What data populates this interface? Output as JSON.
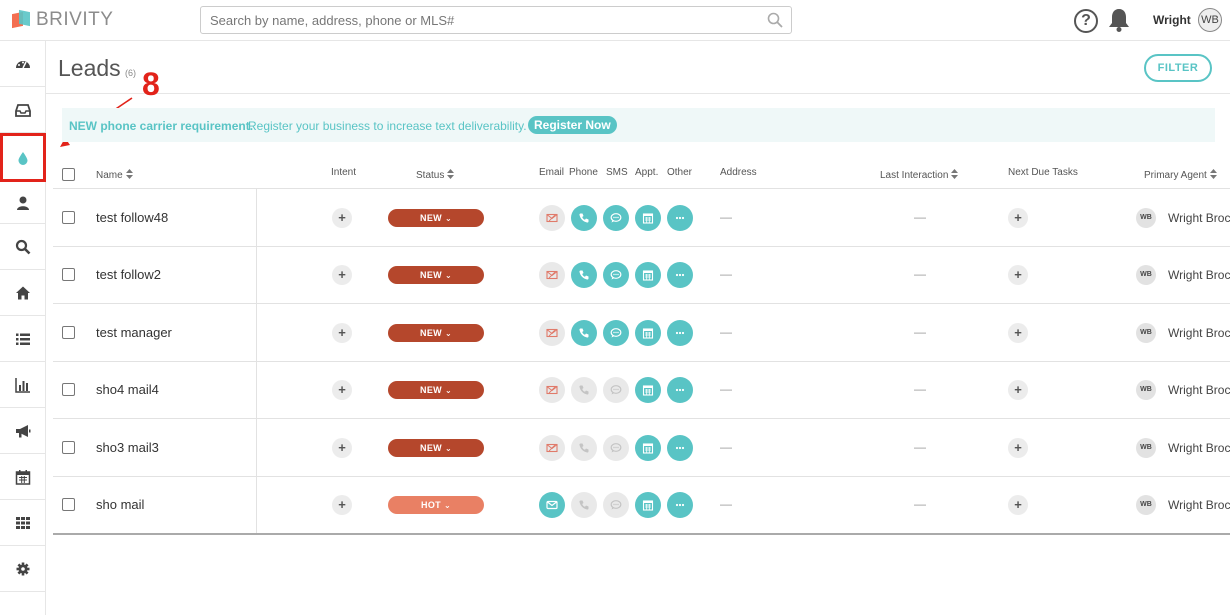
{
  "app": {
    "logo_text": "BRIVITY"
  },
  "search": {
    "placeholder": "Search by name, address, phone or MLS#"
  },
  "topbar": {
    "help_glyph": "?",
    "user_name": "Wright",
    "user_initials": "WB"
  },
  "sidebar": {
    "items": [
      {
        "icon": "dashboard-icon",
        "active": false
      },
      {
        "icon": "inbox-icon",
        "active": false
      },
      {
        "icon": "drop-icon",
        "active": true
      },
      {
        "icon": "person-icon",
        "active": false
      },
      {
        "icon": "search-icon",
        "active": false
      },
      {
        "icon": "home-icon",
        "active": false
      },
      {
        "icon": "list-icon",
        "active": false
      },
      {
        "icon": "bar-chart-icon",
        "active": false
      },
      {
        "icon": "megaphone-icon",
        "active": false
      },
      {
        "icon": "calendar-icon",
        "active": false
      },
      {
        "icon": "grid-icon",
        "active": false
      },
      {
        "icon": "gear-icon",
        "active": false
      }
    ]
  },
  "page": {
    "title": "Leads",
    "count": "(6)",
    "filter_label": "FILTER"
  },
  "annotation": {
    "number": "8"
  },
  "banner": {
    "strong": "NEW phone carrier requirement.",
    "text": "Register your business to increase text deliverability.",
    "button": "Register Now"
  },
  "table": {
    "headers": {
      "name": "Name",
      "intent": "Intent",
      "status": "Status",
      "email": "Email",
      "phone": "Phone",
      "sms": "SMS",
      "appt": "Appt.",
      "other": "Other",
      "address": "Address",
      "last_interaction": "Last Interaction",
      "next_due_tasks": "Next Due Tasks",
      "primary_agent": "Primary Agent"
    },
    "rows": [
      {
        "name": "test follow48",
        "status": "NEW",
        "email_on": false,
        "phone_on": true,
        "sms_on": true,
        "appt_on": true,
        "other_on": true,
        "address": "—",
        "last_interaction": "—",
        "agent_initials": "WB",
        "agent_name": "Wright Brock"
      },
      {
        "name": "test follow2",
        "status": "NEW",
        "email_on": false,
        "phone_on": true,
        "sms_on": true,
        "appt_on": true,
        "other_on": true,
        "address": "—",
        "last_interaction": "—",
        "agent_initials": "WB",
        "agent_name": "Wright Brock"
      },
      {
        "name": "test manager",
        "status": "NEW",
        "email_on": false,
        "phone_on": true,
        "sms_on": true,
        "appt_on": true,
        "other_on": true,
        "address": "—",
        "last_interaction": "—",
        "agent_initials": "WB",
        "agent_name": "Wright Brock"
      },
      {
        "name": "sho4 mail4",
        "status": "NEW",
        "email_on": false,
        "phone_on": false,
        "sms_on": false,
        "appt_on": true,
        "other_on": true,
        "address": "—",
        "last_interaction": "—",
        "agent_initials": "WB",
        "agent_name": "Wright Brock"
      },
      {
        "name": "sho3 mail3",
        "status": "NEW",
        "email_on": false,
        "phone_on": false,
        "sms_on": false,
        "appt_on": true,
        "other_on": true,
        "address": "—",
        "last_interaction": "—",
        "agent_initials": "WB",
        "agent_name": "Wright Brock"
      },
      {
        "name": "sho mail",
        "status": "HOT",
        "email_on": true,
        "phone_on": false,
        "sms_on": false,
        "appt_on": true,
        "other_on": true,
        "address": "—",
        "last_interaction": "—",
        "agent_initials": "WB",
        "agent_name": "Wright Brock"
      }
    ],
    "intent_glyph": "+",
    "task_glyph": "+",
    "status_chevron": "⌄"
  },
  "colors": {
    "accent": "#59c4c5",
    "status_new": "#b5472c",
    "status_hot": "#e98064",
    "annotation": "#e2231a"
  }
}
